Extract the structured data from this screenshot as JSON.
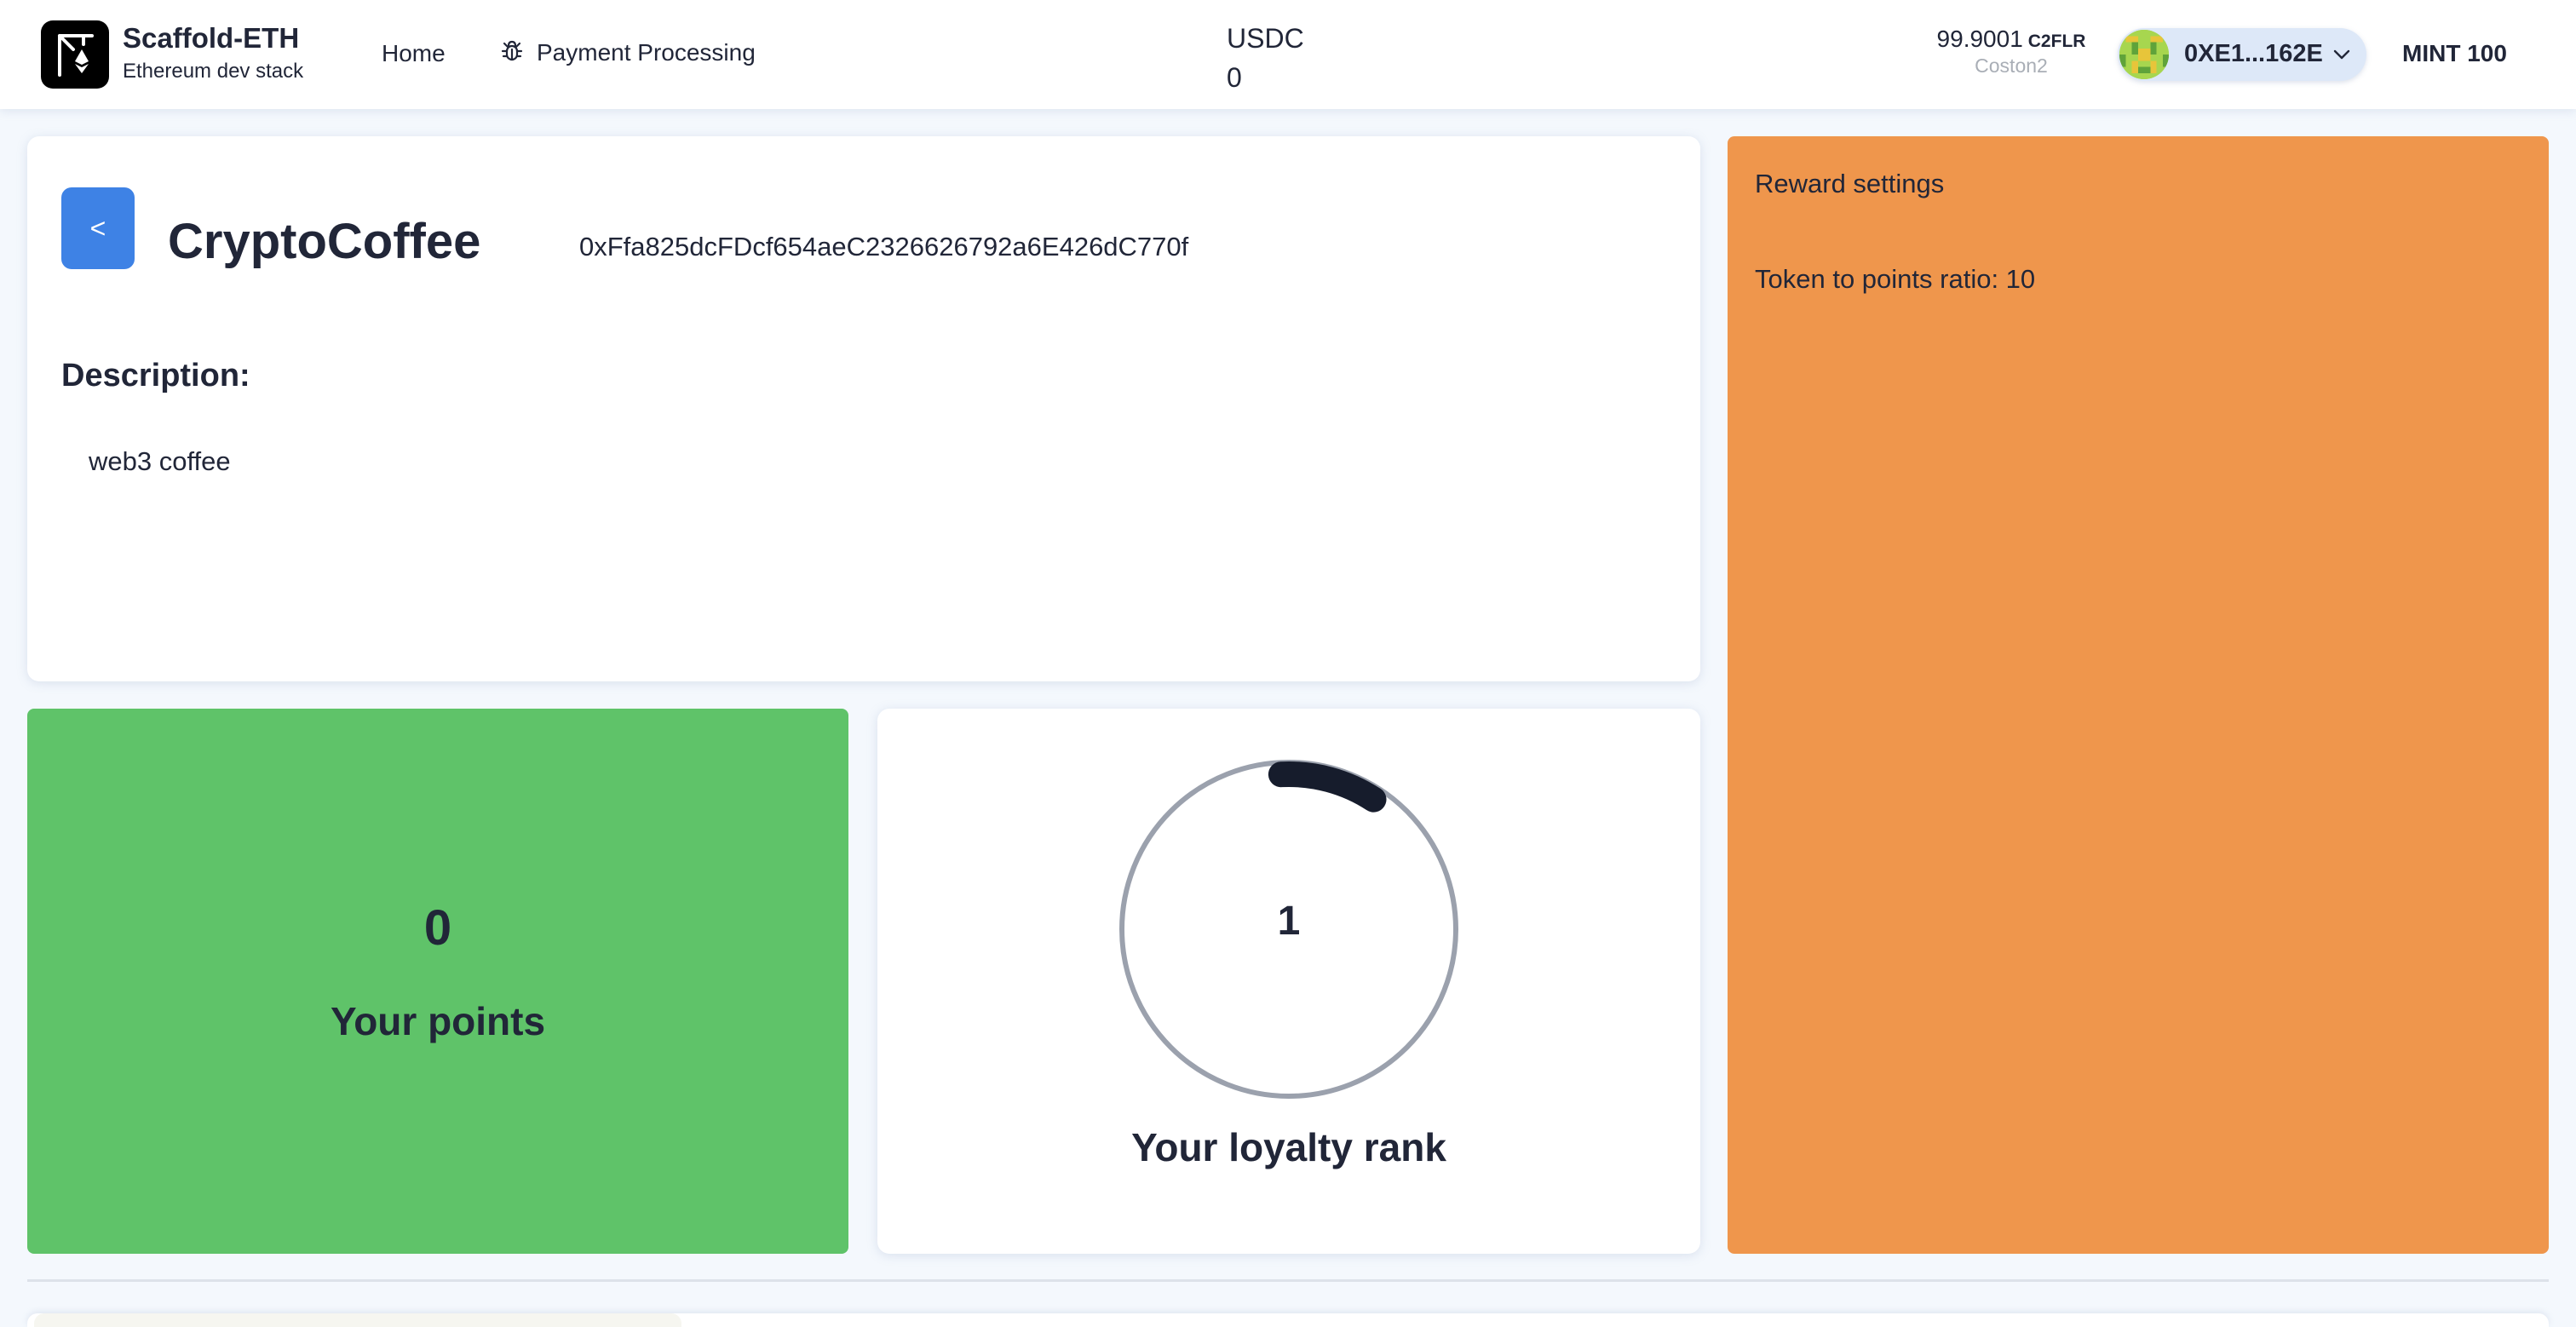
{
  "header": {
    "brand_title": "Scaffold-ETH",
    "brand_subtitle": "Ethereum dev stack",
    "nav": {
      "home": "Home",
      "payment": "Payment Processing"
    },
    "token": {
      "symbol": "USDC",
      "balance": "0"
    },
    "balance": {
      "amount": "99.9001",
      "symbol": "C2FLR",
      "network": "Coston2"
    },
    "account": {
      "address": "0XE1...162E"
    },
    "mint_label": "MINT 100"
  },
  "shop": {
    "back_label": "<",
    "name": "CryptoCoffee",
    "address": "0xFfa825dcFDcf654aeC2326626792a6E426dC770f",
    "description_label": "Description:",
    "description": "web3 coffee"
  },
  "points": {
    "value": "0",
    "label": "Your points"
  },
  "rank": {
    "value": "1",
    "label": "Your loyalty rank",
    "progress_fraction": 0.1
  },
  "reward": {
    "title": "Reward settings",
    "ratio_text": "Token to points ratio: 10"
  },
  "colors": {
    "primary": "#3e82e5",
    "points_card": "#5fc369",
    "reward_card": "#ef964c",
    "background": "#f4f8fd",
    "text": "#212638"
  },
  "icons": {
    "logo": "scaffold-crane-icon",
    "payment": "bug-icon",
    "avatar": "blockie-avatar-icon",
    "account_menu": "chevron-down-icon"
  }
}
